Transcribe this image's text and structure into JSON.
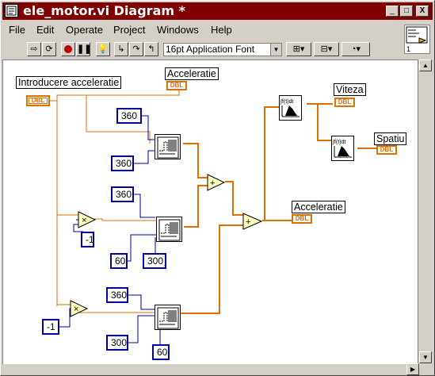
{
  "window": {
    "title": "ele_motor.vi Diagram *"
  },
  "titlebar_buttons": [
    "_",
    "□",
    "X"
  ],
  "menu": [
    {
      "label": "File"
    },
    {
      "label": "Edit"
    },
    {
      "label": "Operate"
    },
    {
      "label": "Project"
    },
    {
      "label": "Windows"
    },
    {
      "label": "Help"
    }
  ],
  "toolbar": {
    "font": "16pt Application Font"
  },
  "connector_pane_number": "1",
  "diagram": {
    "labels": {
      "input_accel": "Introducere acceleratie",
      "out_accel_top": "Acceleratie",
      "out_accel_mid": "Acceleratie",
      "viteza": "Viteza",
      "spatiu": "Spatiu"
    },
    "dbl": "DBL",
    "constants": {
      "c1": "360",
      "c2": "360",
      "c3": "360",
      "c4": "-1",
      "c5": "60",
      "c6": "300",
      "c7": "360",
      "c8": "-1",
      "c9": "300",
      "c10": "60"
    }
  }
}
